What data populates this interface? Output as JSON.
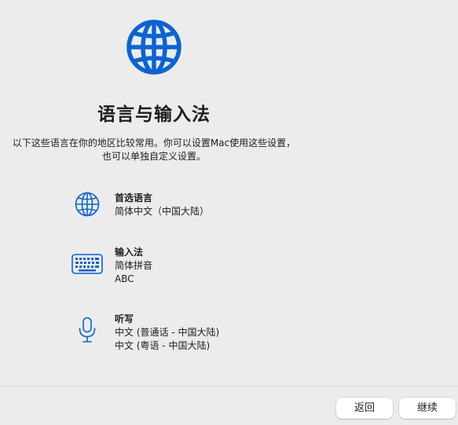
{
  "header": {
    "icon": "globe-icon",
    "title": "语言与输入法",
    "description_line1": "以下这些语言在你的地区比较常用。你可以设置Mac使用这些设置，",
    "description_line2": "也可以单独自定义设置。"
  },
  "settings": {
    "preferred_language": {
      "icon": "globe-icon",
      "label": "首选语言",
      "value": "简体中文（中国大陆）"
    },
    "input_sources": {
      "icon": "keyboard-icon",
      "label": "输入法",
      "values": [
        "简体拼音",
        "ABC"
      ]
    },
    "dictation": {
      "icon": "microphone-icon",
      "label": "听写",
      "values": [
        "中文 (普通话 - 中国大陆)",
        "中文 (粤语 - 中国大陆)"
      ]
    }
  },
  "footer": {
    "back_label": "返回",
    "continue_label": "继续"
  },
  "colors": {
    "accent": "#0a63d6",
    "background": "#ececec"
  }
}
